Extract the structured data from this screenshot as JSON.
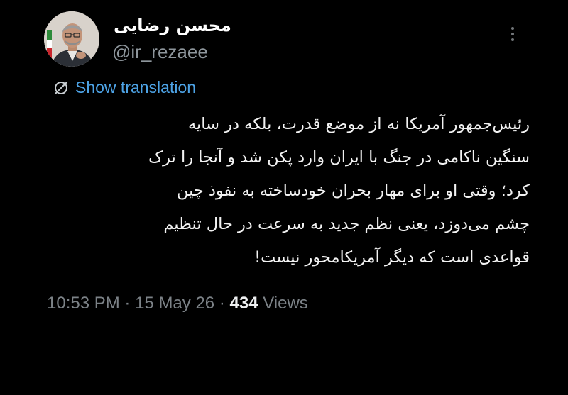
{
  "author": {
    "display_name": "محسن رضایی",
    "handle": "@ir_rezaee"
  },
  "actions": {
    "show_translation": "Show translation",
    "more_icon": "more-vertical-icon",
    "translate_icon": "globe-slash-icon"
  },
  "tweet": {
    "lines": [
      "رئیس‌جمهور آمریکا نه از موضع قدرت، بلکه در سایه",
      "سنگین ناکامی در جنگ با ایران وارد پکن شد و آنجا را ترک",
      "کرد؛ وقتی او برای مهار بحران خودساخته به نفوذ چین",
      "چشم می‌دوزد، یعنی نظم جدید به سرعت در حال تنظیم",
      "قواعدی است که دیگر آمریکامحور نیست!"
    ]
  },
  "meta": {
    "time": "10:53 PM",
    "separator": "·",
    "date": "15 May 26",
    "views_count": "434",
    "views_label": "Views"
  },
  "colors": {
    "background": "#000000",
    "link": "#4da3e6",
    "secondary_text": "#7c8287",
    "primary_text": "#f2f2f2"
  }
}
